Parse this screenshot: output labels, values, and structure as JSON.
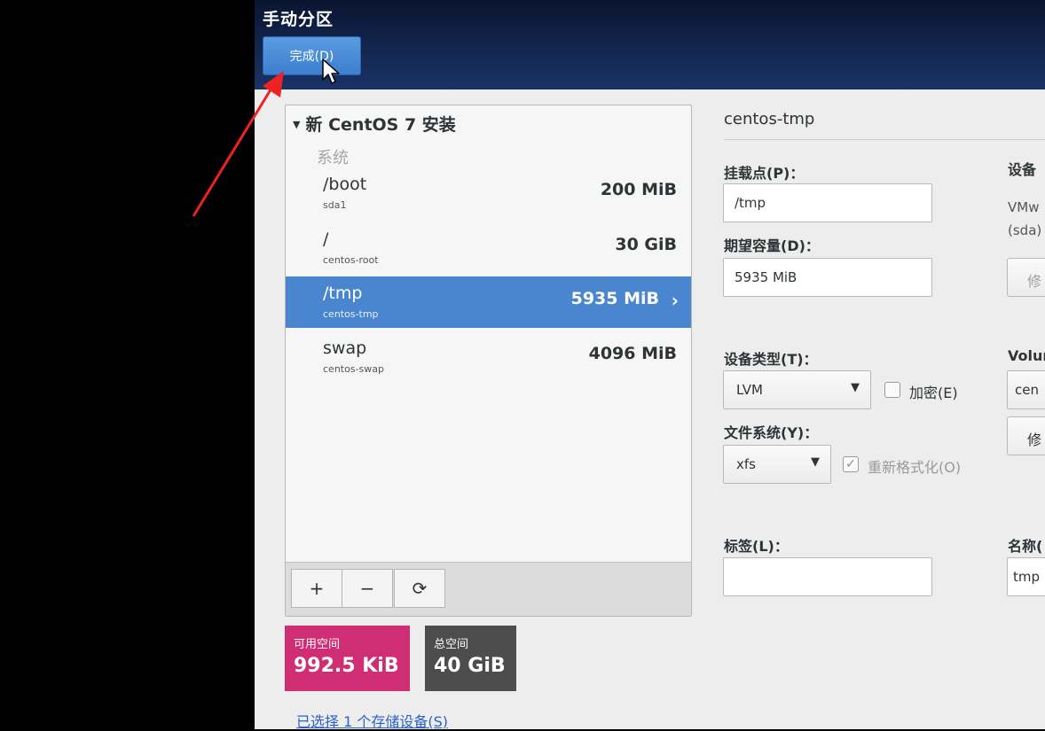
{
  "header": {
    "title": "手动分区",
    "done_label": "完成(D)"
  },
  "partition_list": {
    "install_title": "新 CentOS 7 安装",
    "group_label": "系统",
    "rows": [
      {
        "mount": "/boot",
        "device": "sda1",
        "size": "200 MiB",
        "selected": false
      },
      {
        "mount": "/",
        "device": "centos-root",
        "size": "30 GiB",
        "selected": false
      },
      {
        "mount": "/tmp",
        "device": "centos-tmp",
        "size": "5935 MiB",
        "selected": true
      },
      {
        "mount": "swap",
        "device": "centos-swap",
        "size": "4096 MiB",
        "selected": false
      }
    ],
    "toolbar": {
      "add": "+",
      "remove": "−",
      "refresh": "⟳"
    }
  },
  "space": {
    "available_label": "可用空间",
    "available_value": "992.5 KiB",
    "total_label": "总空间",
    "total_value": "40 GiB"
  },
  "selected_devices_link": "已选择 1 个存储设备(S)",
  "details": {
    "title": "centos-tmp",
    "mount_point_label": "挂载点(P)：",
    "mount_point_value": "/tmp",
    "desired_capacity_label": "期望容量(D)：",
    "desired_capacity_value": "5935 MiB",
    "device_type_label": "设备类型(T)：",
    "device_type_value": "LVM",
    "encrypt_label": "加密(E)",
    "encrypt_checked": false,
    "filesystem_label": "文件系统(Y)：",
    "filesystem_value": "xfs",
    "reformat_label": "重新格式化(O)",
    "reformat_checked": true,
    "label_label": "标签(L)：",
    "label_value": ""
  },
  "side_column": {
    "devices_label": "设备",
    "device_text_1": "VMw",
    "device_text_2": "(sda)",
    "modify_button": "修",
    "volume_group_label": "Volur",
    "volume_group_value": "cen",
    "modify_button_2": "修",
    "name_label": "名称(",
    "name_value": "tmp"
  },
  "colors": {
    "header_bg": "#13264f",
    "done_button": "#4a8ad8",
    "selected_row": "#4a86cf",
    "available_space": "#d02e74",
    "total_space": "#4d4d4d",
    "annotation_arrow": "#ee2222"
  }
}
